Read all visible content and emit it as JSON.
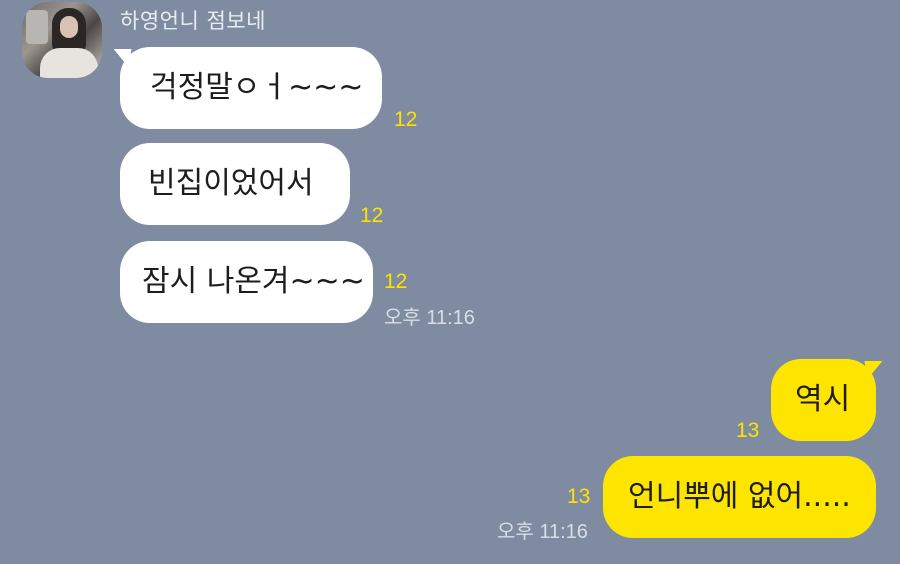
{
  "chat": {
    "sender_name": "하영언니 점보네",
    "messages": [
      {
        "text": "걱정말ㅇㅓ~~~",
        "unread": "12"
      },
      {
        "text": "빈집이었어서",
        "unread": "12"
      },
      {
        "text": "잠시 나온겨~~~",
        "unread": "12",
        "time": "오후 11:16"
      }
    ],
    "sent": [
      {
        "text": "역시",
        "unread": "13"
      },
      {
        "text": "언니뿌에 없어.....",
        "unread": "13",
        "time": "오후 11:16"
      }
    ]
  },
  "colors": {
    "background": "#7f8ba1",
    "incoming_bubble": "#ffffff",
    "outgoing_bubble": "#fee500",
    "unread_count": "#ffe200"
  },
  "icons": {
    "avatar": "profile-photo"
  }
}
